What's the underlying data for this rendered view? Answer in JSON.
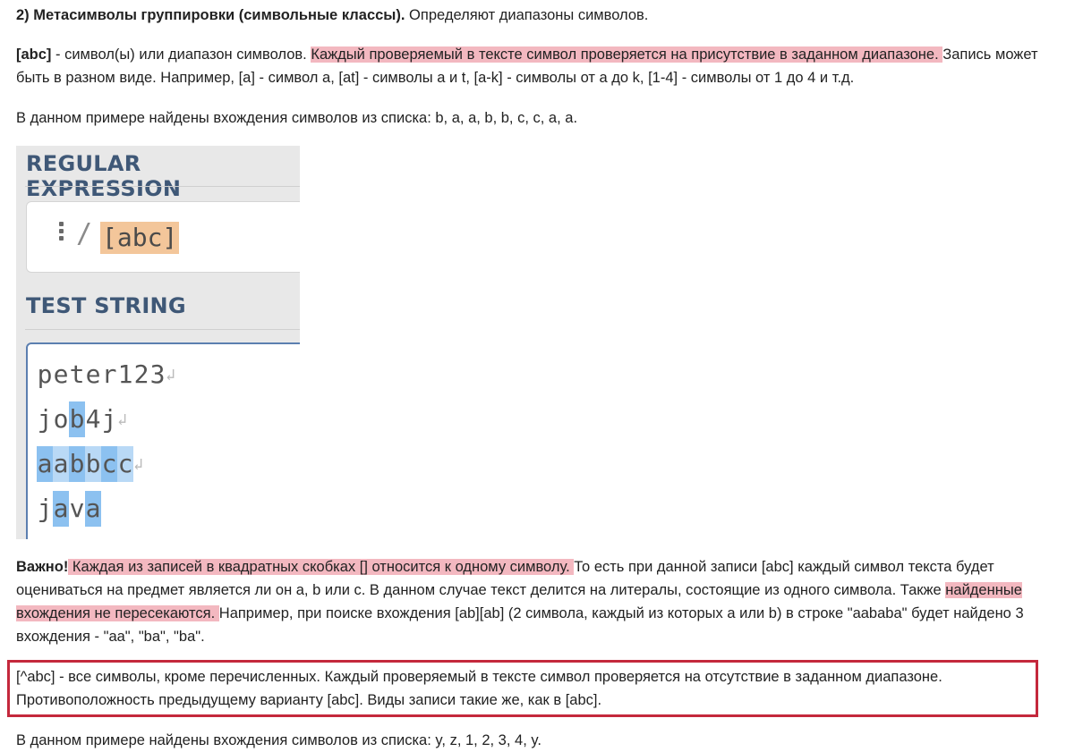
{
  "section": {
    "heading_bold": "2) Метасимволы группировки (символьные классы).",
    "heading_rest": " Определяют диапазоны символов."
  },
  "abc_para": {
    "term": "[abc]",
    "part1": " - символ(ы) или диапазон символов. ",
    "highlight": "Каждый проверяемый в тексте символ проверяется на присутствие в заданном диапазоне. ",
    "part2": "Запись может быть в разном виде. Например, [a] - символ a, [at] - символы a и t, [a-k] - символы от a до k, [1-4] - символы от 1 до 4 и т.д."
  },
  "example1": "В данном примере найдены вхождения символов из списка: b, a, a, b, b, c, c, a, a.",
  "screenshot": {
    "regex_title": "REGULAR EXPRESSION",
    "slash": "/",
    "expression": "[abc]",
    "test_title": "TEST STRING",
    "lines": [
      "peter123",
      "job4j",
      "aabbcc",
      "java"
    ],
    "newline_glyph": "↲"
  },
  "important": {
    "label": "Важно!",
    "highlight1": " Каждая из записей в квадратных скобках [] относится к одному символу. ",
    "part1": "То есть при данной записи [abc] каждый символ текста будет оцениваться на предмет является ли он a, b или c. В данном случае текст делится на литералы, состоящие из одного символа. Также ",
    "highlight2": "найденные вхождения не пересекаются. ",
    "part2": "Например, при поиске вхождения [ab][ab] (2 символа, каждый из которых a или b) в строке \"aababa\" будет найдено 3 вхождения - \"aa\", \"ba\", \"ba\"."
  },
  "negated": {
    "text": "[^abc] - все символы, кроме перечисленных. Каждый проверяемый в тексте символ проверяется на отсутствие в заданном диапазоне. Противоположность предыдущему варианту [abc]. Виды записи такие же, как в [abc]."
  },
  "example2": "В данном примере найдены вхождения символов из списка: y, z, 1, 2, 3, 4, y.",
  "colors": {
    "highlight": "#f3b8c0",
    "box_border": "#c4283c",
    "match_light": "#b9d9f6",
    "match_dark": "#8cc1f0",
    "regex_highlight": "#f3c69a"
  }
}
